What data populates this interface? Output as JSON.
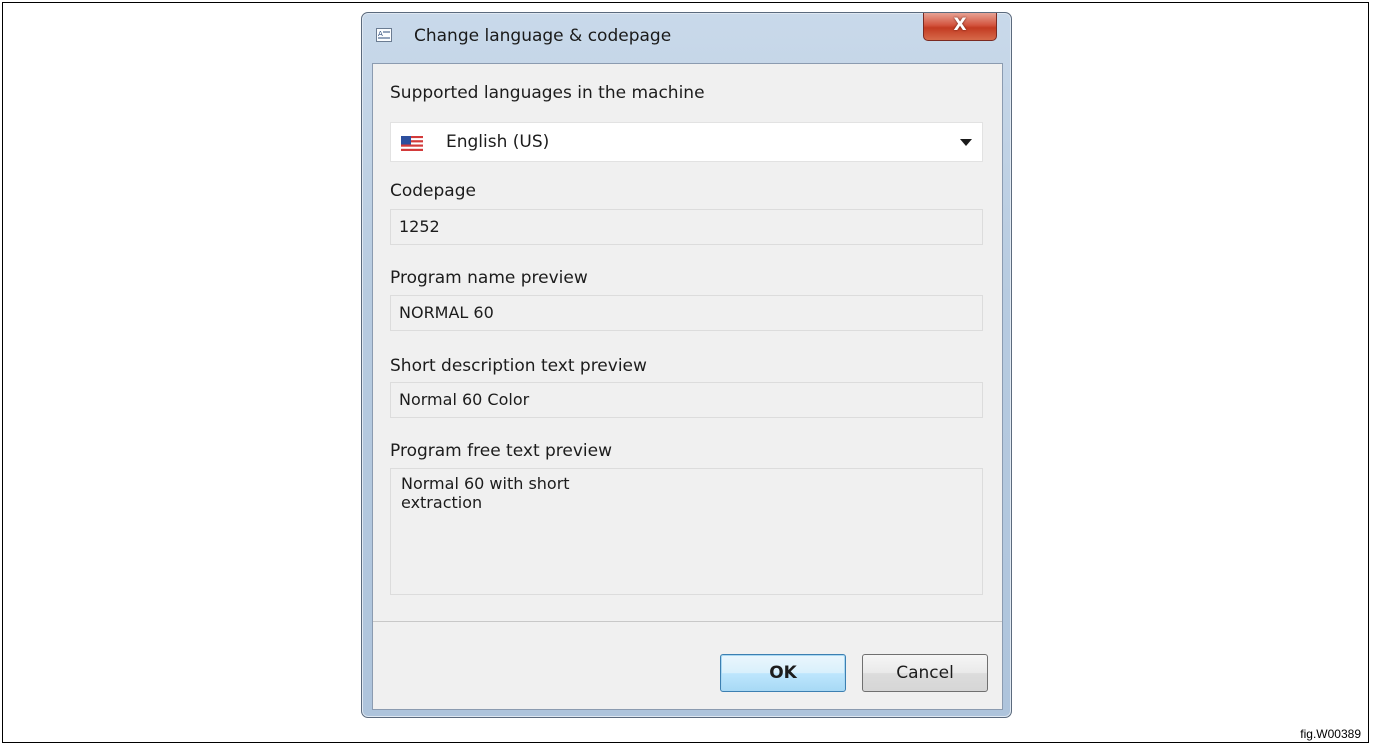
{
  "window": {
    "title": "Change language & codepage",
    "close_label": "X"
  },
  "language": {
    "label": "Supported languages in the machine",
    "selected": "English (US)",
    "flag_icon": "us-flag-icon"
  },
  "codepage": {
    "label": "Codepage",
    "value": "1252"
  },
  "program_name": {
    "label": "Program name preview",
    "value": "NORMAL 60"
  },
  "short_description": {
    "label": "Short description text preview",
    "value": "Normal 60 Color"
  },
  "free_text": {
    "label": "Program free text preview",
    "value": "Normal 60 with short\nextraction"
  },
  "buttons": {
    "ok": "OK",
    "cancel": "Cancel"
  },
  "figure": {
    "caption": "fig.W00389"
  },
  "colors": {
    "accent_ok_border": "#3c7fb1",
    "close_red": "#c33b22",
    "window_frame": "#b7cbe0",
    "client_bg": "#f0f0f0"
  }
}
